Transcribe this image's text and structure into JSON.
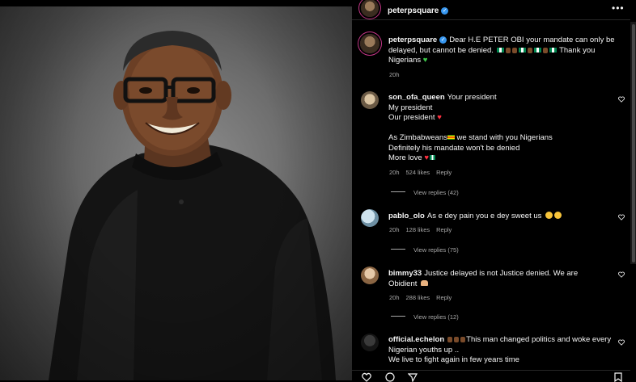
{
  "post": {
    "author": "peterpsquare",
    "caption_text": "Dear H.E PETER OBI your mandate can only be delayed, but cannot be denied.",
    "caption_end": "Thank you Nigerians",
    "caption_time": "20h"
  },
  "icons": {
    "more": "more-icon",
    "verified": "verified-icon",
    "heart": "heart-icon",
    "like": "like-icon",
    "comment": "comment-icon",
    "share": "share-icon",
    "save": "save-icon"
  },
  "comments": [
    {
      "username": "son_ofa_queen",
      "lines": [
        "Your president",
        "My president",
        "Our president",
        "",
        "As Zimbabweans",
        "we stand with you Nigerians",
        "Definitely his mandate won't be denied",
        "More love"
      ],
      "time": "20h",
      "likes": "524 likes",
      "reply": "Reply",
      "view_replies": "View replies (42)"
    },
    {
      "username": "pablo_olo",
      "text": "As e dey pain you e dey sweet us",
      "time": "20h",
      "likes": "128 likes",
      "reply": "Reply",
      "view_replies": "View replies (75)"
    },
    {
      "username": "bimmy33",
      "text": "Justice delayed is not Justice denied. We are Obidient",
      "time": "20h",
      "likes": "288 likes",
      "reply": "Reply",
      "view_replies": "View replies (12)"
    },
    {
      "username": "official.echelon",
      "text": "This man changed politics and woke every Nigerian youths up ..",
      "text2": "We live to fight again in few years time"
    }
  ],
  "colors": {
    "background": "#000000",
    "text": "#f5f5f5",
    "secondary_text": "#a8a8a8",
    "verified": "#3797f0"
  }
}
